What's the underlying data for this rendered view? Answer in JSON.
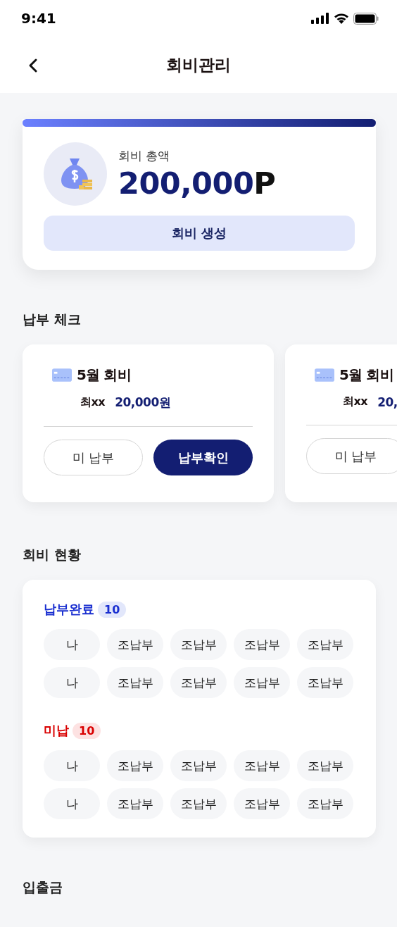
{
  "status_bar": {
    "time": "9:41"
  },
  "header": {
    "title": "회비관리"
  },
  "total": {
    "label": "회비 총액",
    "amount": "200,000",
    "unit": "P",
    "button": "회비 생성"
  },
  "payment_check": {
    "title": "납부 체크",
    "cards": [
      {
        "title": "5월 회비",
        "name": "최xx",
        "amount": "20,000원",
        "buttons": [
          {
            "label": "미 납부",
            "kind": "outline"
          },
          {
            "label": "납부확인",
            "kind": "filled"
          }
        ]
      },
      {
        "title": "5월 회비",
        "name": "최xx",
        "amount": "20,",
        "buttons": [
          {
            "label": "미 납부",
            "kind": "outline"
          }
        ]
      }
    ]
  },
  "status": {
    "title": "회비 현황",
    "groups": [
      {
        "label": "납부완료",
        "count": "10",
        "kind": "paid",
        "members": [
          "나",
          "조납부",
          "조납부",
          "조납부",
          "조납부",
          "나",
          "조납부",
          "조납부",
          "조납부",
          "조납부"
        ]
      },
      {
        "label": "미납",
        "count": "10",
        "kind": "unpaid",
        "members": [
          "나",
          "조납부",
          "조납부",
          "조납부",
          "조납부",
          "나",
          "조납부",
          "조납부",
          "조납부",
          "조납부"
        ]
      }
    ]
  },
  "transactions": {
    "title": "입출금"
  }
}
